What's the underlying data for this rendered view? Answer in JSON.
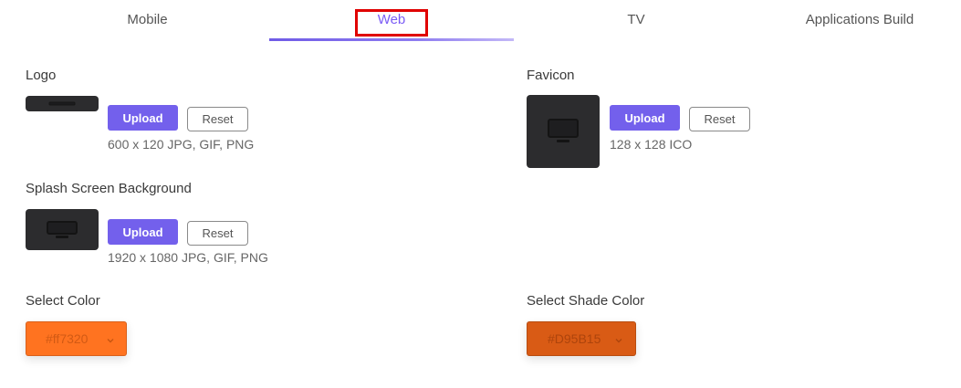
{
  "tabs": [
    {
      "label": "Mobile"
    },
    {
      "label": "Web"
    },
    {
      "label": "TV"
    },
    {
      "label": "Applications Build"
    }
  ],
  "logo": {
    "label": "Logo",
    "upload_label": "Upload",
    "reset_label": "Reset",
    "hint": "600 x 120 JPG, GIF, PNG"
  },
  "favicon": {
    "label": "Favicon",
    "upload_label": "Upload",
    "reset_label": "Reset",
    "hint": "128 x 128 ICO"
  },
  "splash": {
    "label": "Splash Screen Background",
    "upload_label": "Upload",
    "reset_label": "Reset",
    "hint": "1920 x 1080 JPG, GIF, PNG"
  },
  "select_color": {
    "label": "Select Color",
    "value": "#ff7320",
    "chevron_icon": "chevron-down-icon"
  },
  "select_shade_color": {
    "label": "Select Shade Color",
    "value": "#D95B15",
    "chevron_icon": "chevron-down-icon"
  },
  "colors": {
    "accent": "#7360ec",
    "active_tab_outline": "#e00000",
    "thumbnail_bg": "#2c2c2e",
    "primary_swatch": "#ff7320",
    "shade_swatch": "#D95B15"
  },
  "icons": {
    "placeholder": "monitor-icon"
  }
}
